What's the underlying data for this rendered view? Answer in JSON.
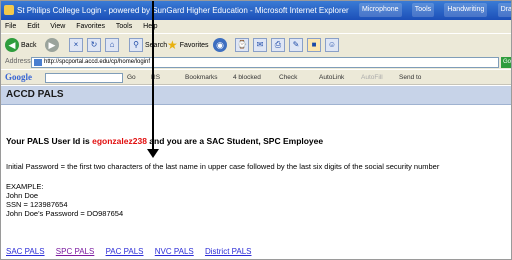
{
  "window": {
    "title": "St Philips College Login - powered by SunGard Higher Education - Microsoft Internet Explorer",
    "tasks": [
      "Microphone",
      "Tools",
      "Handwriting",
      "Drawing Pad"
    ]
  },
  "menu": [
    "File",
    "Edit",
    "View",
    "Favorites",
    "Tools",
    "Help"
  ],
  "toolbar": {
    "back": "Back",
    "search": "Search",
    "favorites": "Favorites"
  },
  "address": {
    "label": "Address",
    "url": "http://spcportal.accd.edu/cp/home/loginf",
    "go": "Go"
  },
  "google": {
    "logo": "Google",
    "search_label": "Search",
    "items": [
      "Go",
      "RS",
      "Bookmarks",
      "4 blocked",
      "Check",
      "AutoLink",
      "AutoFill",
      "Send to"
    ]
  },
  "page": {
    "header": "ACCD PALS",
    "user_prefix": "Your PALS User Id is ",
    "user_id": "egonzalez238",
    "user_suffix": " and you are a SAC Student, SPC Employee",
    "password_rule": "Initial Password = the first two characters of the last name in upper case followed by the last six digits of the social security number",
    "example_lines": [
      "EXAMPLE:",
      "John Doe",
      "SSN = 123987654",
      "John Doe's Password = DO987654"
    ],
    "links": [
      "SAC PALS",
      "SPC PALS",
      "PAC PALS",
      "NVC PALS",
      "District PALS"
    ]
  },
  "colors": {
    "user_id": "#e10d0d",
    "link": "#2b2bd6",
    "visited_link": "#7a1aa0",
    "header_bg": "#c7d3e8"
  }
}
